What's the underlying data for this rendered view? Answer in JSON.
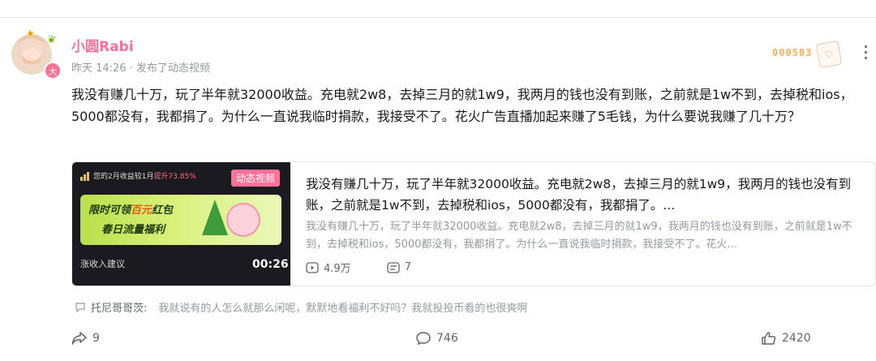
{
  "post": {
    "username": "小圆Rabi",
    "level_badge": "大",
    "time": "昨天 14:26",
    "separator": "·",
    "action": "发布了动态视频",
    "fan_badge_number": "000503",
    "text": "我没有赚几十万，玩了半年就32000收益。充电就2w8，去掉三月的就1w9，我两月的钱也没有到账，之前就是1w不到，去掉税和ios，5000都没有，我都捐了。为什么一直说我临时捐款，我接受不了。花火广告直播加起来赚了5毛钱，为什么要说我赚了几十万？"
  },
  "video_card": {
    "tag": "动态视频",
    "thumb_top_text": "您的2月收益较1月",
    "thumb_top_highlight": "提升73.85%",
    "banner_line1_a": "限时可领",
    "banner_line1_hl": "百元",
    "banner_line1_b": "红包",
    "banner_line2": "春日流量福利",
    "thumb_bottom_text": "涨收入建议",
    "duration": "00:26",
    "title": "我没有赚几十万，玩了半年就32000收益。充电就2w8，去掉三月的就1w9，我两月的钱也没有到账，之前就是1w不到，去掉税和ios，5000都没有，我都捐了。...",
    "description": "我没有赚几十万，玩了半年就32000收益。充电就2w8，去掉三月的就1w9，我两月的钱也没有到账，之前就是1w不到，去掉税和ios，5000都没有，我都捐了。为什么一直说我临时捐款，我接受不了。花火...",
    "views": "4.9万",
    "danmaku": "7"
  },
  "hot_comment": {
    "user": "托尼哥哥茨:",
    "text": "我就说有的人怎么就那么闲呢，默默地看福利不好吗？我就投投币看的也很爽啊"
  },
  "actions": {
    "share": "9",
    "comment": "746",
    "like": "2420"
  },
  "colors": {
    "accent_pink": "#fb7299",
    "text_primary": "#18191c",
    "text_secondary": "#9499a0",
    "text_muted": "#61666d"
  }
}
